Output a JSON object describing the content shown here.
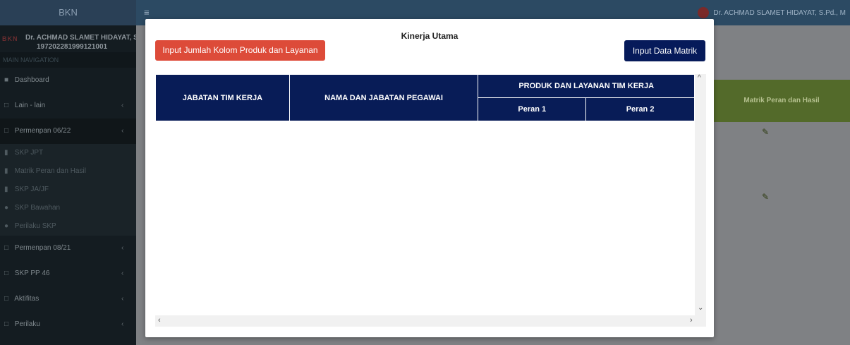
{
  "app": {
    "brand": "BKN",
    "top_user": "Dr. ACHMAD SLAMET HIDAYAT, S.Pd., M"
  },
  "sidebar": {
    "logo": "BKN",
    "user_name": "Dr. ACHMAD SLAMET HIDAYAT, S",
    "user_nip": "197202281999121001",
    "nav_header": "MAIN NAVIGATION",
    "items": [
      {
        "label": "Dashboard",
        "icon": "dashboard-icon"
      },
      {
        "label": "Lain - lain",
        "icon": "folder-icon"
      },
      {
        "label": "Permenpan 06/22",
        "icon": "folder-icon"
      }
    ],
    "sub_items": [
      {
        "label": "SKP JPT",
        "icon": "book-icon"
      },
      {
        "label": "Matrik Peran dan Hasil",
        "icon": "book-icon"
      },
      {
        "label": "SKP JA/JF",
        "icon": "book-icon"
      },
      {
        "label": "SKP Bawahan",
        "icon": "users-icon"
      },
      {
        "label": "Perilaku SKP",
        "icon": "users-icon"
      }
    ],
    "items_after": [
      {
        "label": "Permenpan 08/21",
        "icon": "folder-icon"
      },
      {
        "label": "SKP PP 46",
        "icon": "folder-icon"
      },
      {
        "label": "Aktifitas",
        "icon": "folder-icon"
      },
      {
        "label": "Perilaku",
        "icon": "folder-icon"
      }
    ]
  },
  "background": {
    "column_header": "Matrik Peran dan Hasil"
  },
  "modal": {
    "title": "Kinerja Utama",
    "btn_input_kolom": "Input Jumlah Kolom Produk dan Layanan",
    "btn_input_matrik": "Input Data Matrik",
    "table": {
      "col_jabatan": "JABATAN TIM KERJA",
      "col_nama": "NAMA DAN JABATAN PEGAWAI",
      "col_group": "PRODUK DAN LAYANAN TIM KERJA",
      "sub_cols": [
        "Peran 1",
        "Peran 2"
      ]
    }
  },
  "colors": {
    "red_button": "#dd4b39",
    "navy_button": "#061a5a",
    "table_header": "#081c57",
    "olive_header": "#536a2a"
  }
}
